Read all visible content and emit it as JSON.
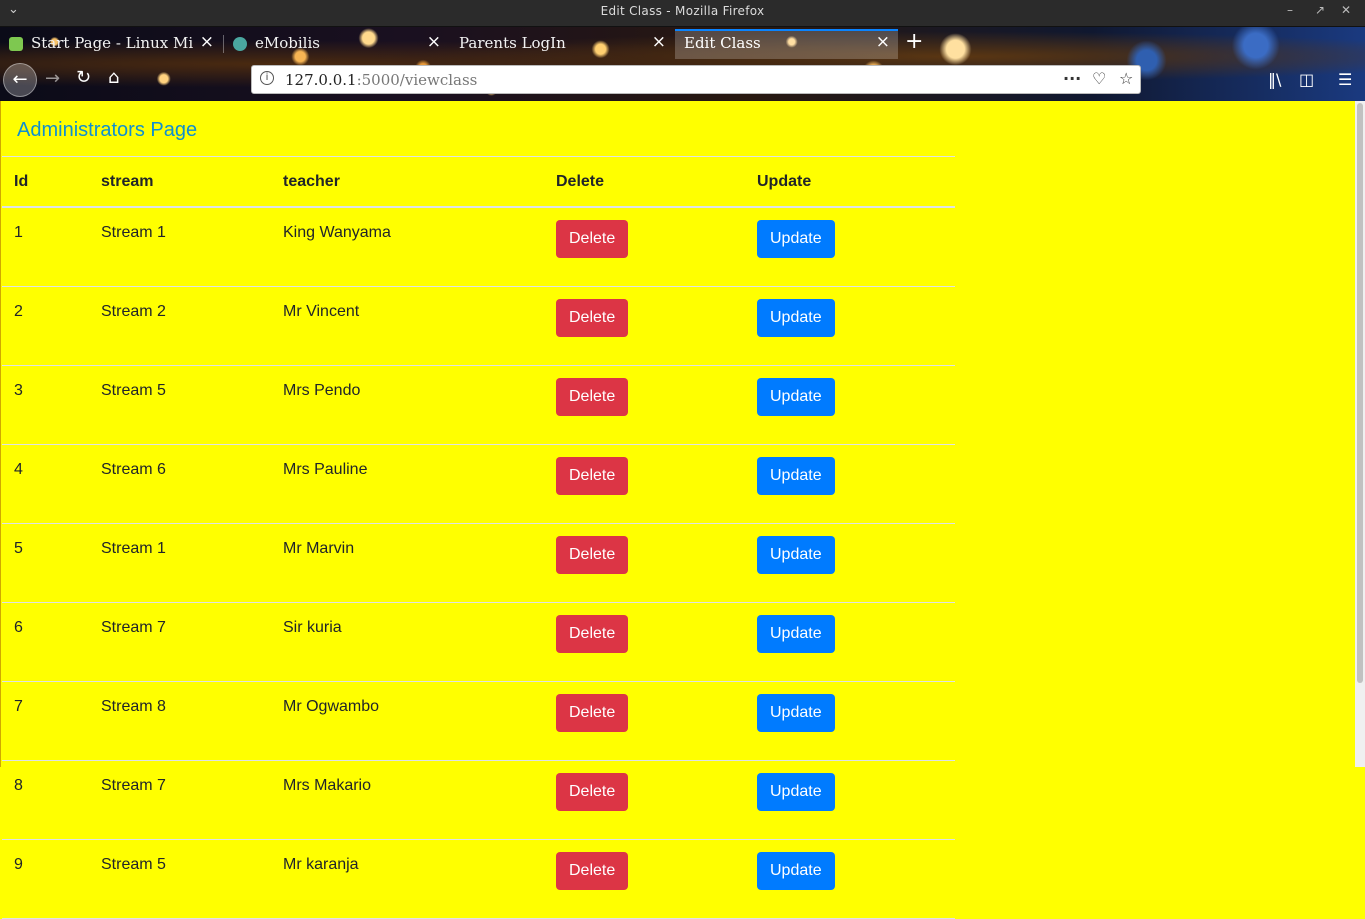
{
  "window": {
    "title": "Edit Class - Mozilla Firefox"
  },
  "tabs": [
    {
      "label": "Start Page - Linux Mi",
      "favicon_color": "#7ec850",
      "active": false
    },
    {
      "label": "eMobilis",
      "favicon_color": "#4aa7a0",
      "active": false
    },
    {
      "label": "Parents LogIn",
      "favicon_color": "",
      "active": false
    },
    {
      "label": "Edit Class",
      "favicon_color": "",
      "active": true
    }
  ],
  "toolbar": {
    "url_host": "127.0.0.1",
    "url_path": ":5000/viewclass"
  },
  "page": {
    "brand": "Administrators Page",
    "columns": [
      "Id",
      "stream",
      "teacher",
      "Delete",
      "Update"
    ],
    "rows": [
      {
        "id": "1",
        "stream": "Stream 1",
        "teacher": "King Wanyama"
      },
      {
        "id": "2",
        "stream": "Stream 2",
        "teacher": "Mr Vincent"
      },
      {
        "id": "3",
        "stream": "Stream 5",
        "teacher": "Mrs Pendo"
      },
      {
        "id": "4",
        "stream": "Stream 6",
        "teacher": "Mrs Pauline"
      },
      {
        "id": "5",
        "stream": "Stream 1",
        "teacher": "Mr Marvin"
      },
      {
        "id": "6",
        "stream": "Stream 7",
        "teacher": "Sir kuria"
      },
      {
        "id": "7",
        "stream": "Stream 8",
        "teacher": "Mr Ogwambo"
      },
      {
        "id": "8",
        "stream": "Stream 7",
        "teacher": "Mrs Makario"
      },
      {
        "id": "9",
        "stream": "Stream 5",
        "teacher": "Mr karanja"
      }
    ],
    "delete_label": "Delete",
    "update_label": "Update"
  },
  "colors": {
    "page_background": "#ffff00",
    "brand": "#0f8fd0",
    "danger": "#dc3545",
    "primary": "#007bff"
  }
}
